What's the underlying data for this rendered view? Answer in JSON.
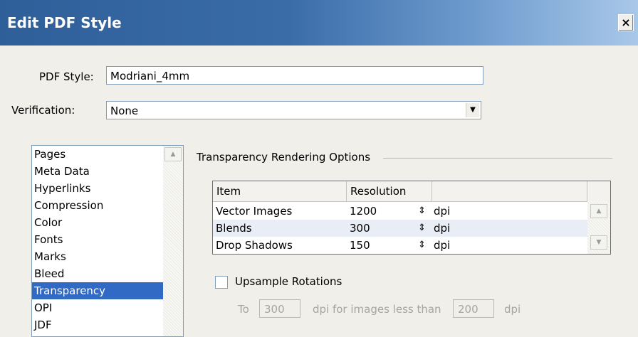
{
  "window": {
    "title": "Edit PDF Style",
    "close_glyph": "×"
  },
  "pdf_style": {
    "label": "PDF Style:",
    "value": "Modriani_4mm"
  },
  "verification": {
    "label": "Verification:",
    "value": "None",
    "arrow_icon": "chevron-down-icon"
  },
  "sidebar": {
    "items": [
      {
        "label": "Pages"
      },
      {
        "label": "Meta Data"
      },
      {
        "label": "Hyperlinks"
      },
      {
        "label": "Compression"
      },
      {
        "label": "Color"
      },
      {
        "label": "Fonts"
      },
      {
        "label": "Marks"
      },
      {
        "label": "Bleed"
      },
      {
        "label": "Transparency",
        "selected": true
      },
      {
        "label": "OPI"
      },
      {
        "label": "JDF"
      }
    ]
  },
  "transparency": {
    "group_title": "Transparency Rendering Options",
    "columns": [
      "Item",
      "Resolution"
    ],
    "rows": [
      {
        "item": "Vector Images",
        "resolution": "1200",
        "unit": "dpi"
      },
      {
        "item": "Blends",
        "resolution": "300",
        "unit": "dpi"
      },
      {
        "item": "Drop Shadows",
        "resolution": "150",
        "unit": "dpi"
      }
    ],
    "upsample": {
      "label": "Upsample Rotations",
      "checked": false,
      "to_label": "To",
      "to_value": "300",
      "middle_label": "dpi for images less than",
      "threshold_value": "200",
      "unit_label": "dpi"
    }
  },
  "colors": {
    "title_bar": "#2f5f99",
    "selection": "#316ac5",
    "row_alt": "#e9eef6"
  }
}
